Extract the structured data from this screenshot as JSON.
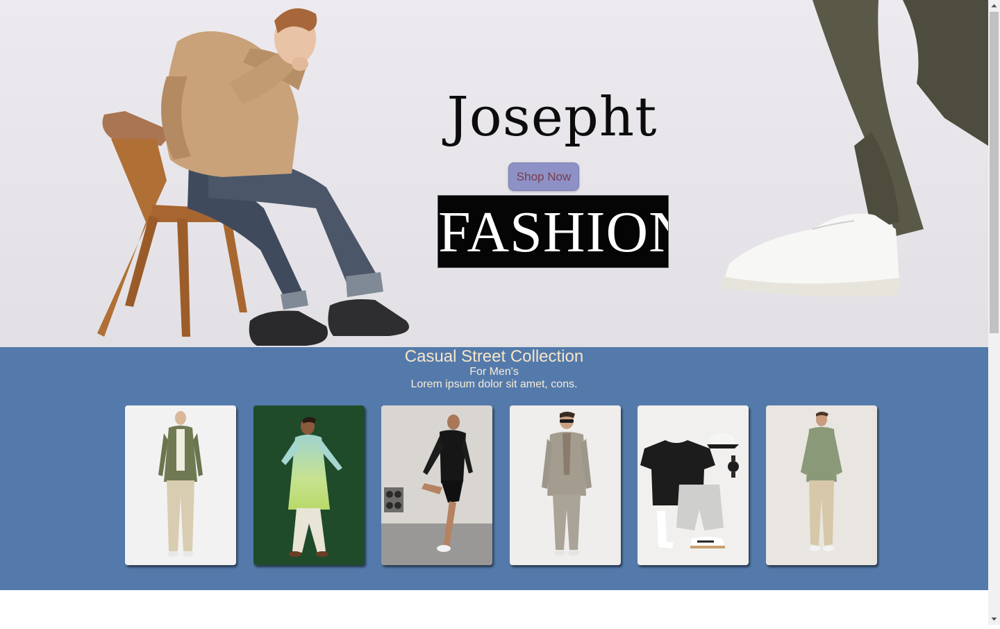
{
  "hero": {
    "brand_name": "Josepht",
    "cta_label": "Shop Now",
    "logo_text": "FASHION"
  },
  "collection": {
    "title": "Casual Street Collection",
    "subtitle": "For Men's",
    "description": "Lorem ipsum dolor sit amet, cons.",
    "background": "#547aab",
    "cards": [
      {
        "name": "olive-jacket-outfit"
      },
      {
        "name": "ombre-kurta-outfit"
      },
      {
        "name": "black-activewear-outfit"
      },
      {
        "name": "grey-suit-outfit"
      },
      {
        "name": "tee-shorts-flatlay"
      },
      {
        "name": "sage-shirt-outfit"
      }
    ]
  },
  "scrollbar": {
    "up_icon": "scroll-up-arrow-icon",
    "down_icon": "scroll-down-arrow-icon"
  }
}
